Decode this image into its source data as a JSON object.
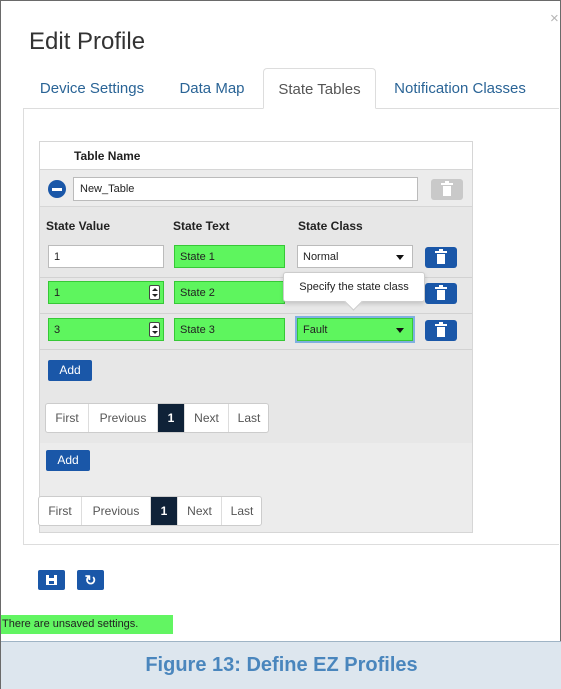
{
  "dialog": {
    "title": "Edit Profile",
    "close_glyph": "×"
  },
  "tabs": [
    {
      "label": "Device Settings",
      "active": false
    },
    {
      "label": "Data Map",
      "active": false
    },
    {
      "label": "State Tables",
      "active": true
    },
    {
      "label": "Notification Classes",
      "active": false
    }
  ],
  "table": {
    "header": "Table Name",
    "name_value": "New_Table",
    "columns": {
      "value": "State Value",
      "text": "State Text",
      "class": "State Class"
    },
    "rows": [
      {
        "value": "1",
        "text": "State 1",
        "class": "Normal"
      },
      {
        "value": "1",
        "text": "State 2",
        "class": ""
      },
      {
        "value": "3",
        "text": "State 3",
        "class": "Fault"
      }
    ],
    "tooltip": "Specify the state class",
    "add_label": "Add"
  },
  "pager_inner": {
    "first": "First",
    "previous": "Previous",
    "page": "1",
    "next": "Next",
    "last": "Last"
  },
  "pager_outer": {
    "first": "First",
    "previous": "Previous",
    "page": "1",
    "next": "Next",
    "last": "Last"
  },
  "outer_add_label": "Add",
  "status_message": "There are unsaved settings.",
  "caption": "Figure 13: Define EZ Profiles",
  "colors": {
    "accent_blue": "#1a57a8",
    "highlight_green": "#5ef55e",
    "pager_active": "#0f2238",
    "caption_text": "#4a86bd"
  },
  "icons": [
    "close-icon",
    "minus-circle-icon",
    "trash-icon",
    "spinner-arrows-icon",
    "chevron-down-icon",
    "save-icon",
    "refresh-icon"
  ]
}
